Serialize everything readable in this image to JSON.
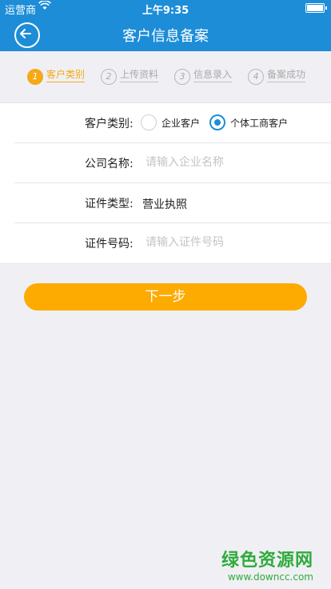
{
  "status_bar": {
    "carrier": "运营商",
    "time": "上午9:35"
  },
  "header": {
    "title": "客户信息备案"
  },
  "steps": [
    {
      "num": "1",
      "label": "客户类别",
      "active": true
    },
    {
      "num": "2",
      "label": "上传资料",
      "active": false
    },
    {
      "num": "3",
      "label": "信息录入",
      "active": false
    },
    {
      "num": "4",
      "label": "备案成功",
      "active": false
    }
  ],
  "form": {
    "customer_type": {
      "label": "客户类别:",
      "options": [
        "企业客户",
        "个体工商客户"
      ],
      "selected": "个体工商客户"
    },
    "company_name": {
      "label": "公司名称:",
      "placeholder": "请输入企业名称",
      "value": ""
    },
    "cert_type": {
      "label": "证件类型:",
      "value": "营业执照"
    },
    "cert_number": {
      "label": "证件号码:",
      "placeholder": "请输入证件号码",
      "value": ""
    }
  },
  "next_button": {
    "label": "下一步"
  },
  "watermark": {
    "title": "绿色资源网",
    "url": "www.downcc.com"
  },
  "colors": {
    "primary": "#1d8dd8",
    "accent": "#fdab00",
    "step_active": "#f5a917",
    "watermark": "#2eab3b"
  }
}
